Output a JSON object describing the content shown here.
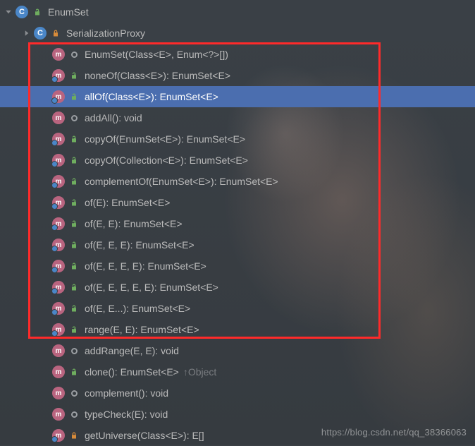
{
  "root": {
    "label": "EnumSet"
  },
  "innerClass": {
    "label": "SerializationProxy"
  },
  "members": [
    {
      "kind": "ctor",
      "vis": "pkg",
      "static": false,
      "label": "EnumSet(Class<E>, Enum<?>[])",
      "selected": false,
      "highlighted": true
    },
    {
      "kind": "method",
      "vis": "public",
      "static": true,
      "label": "noneOf(Class<E>): EnumSet<E>",
      "selected": false,
      "highlighted": true
    },
    {
      "kind": "method",
      "vis": "public",
      "static": true,
      "label": "allOf(Class<E>): EnumSet<E>",
      "selected": true,
      "highlighted": true
    },
    {
      "kind": "method",
      "vis": "pkg",
      "static": false,
      "label": "addAll(): void",
      "selected": false,
      "highlighted": true
    },
    {
      "kind": "method",
      "vis": "public",
      "static": true,
      "label": "copyOf(EnumSet<E>): EnumSet<E>",
      "selected": false,
      "highlighted": true
    },
    {
      "kind": "method",
      "vis": "public",
      "static": true,
      "label": "copyOf(Collection<E>): EnumSet<E>",
      "selected": false,
      "highlighted": true
    },
    {
      "kind": "method",
      "vis": "public",
      "static": true,
      "label": "complementOf(EnumSet<E>): EnumSet<E>",
      "selected": false,
      "highlighted": true
    },
    {
      "kind": "method",
      "vis": "public",
      "static": true,
      "label": "of(E): EnumSet<E>",
      "selected": false,
      "highlighted": true
    },
    {
      "kind": "method",
      "vis": "public",
      "static": true,
      "label": "of(E, E): EnumSet<E>",
      "selected": false,
      "highlighted": true
    },
    {
      "kind": "method",
      "vis": "public",
      "static": true,
      "label": "of(E, E, E): EnumSet<E>",
      "selected": false,
      "highlighted": true
    },
    {
      "kind": "method",
      "vis": "public",
      "static": true,
      "label": "of(E, E, E, E): EnumSet<E>",
      "selected": false,
      "highlighted": true
    },
    {
      "kind": "method",
      "vis": "public",
      "static": true,
      "label": "of(E, E, E, E, E): EnumSet<E>",
      "selected": false,
      "highlighted": true
    },
    {
      "kind": "method",
      "vis": "public",
      "static": true,
      "label": "of(E, E...): EnumSet<E>",
      "selected": false,
      "highlighted": true
    },
    {
      "kind": "method",
      "vis": "public",
      "static": true,
      "label": "range(E, E): EnumSet<E>",
      "selected": false,
      "highlighted": true
    },
    {
      "kind": "method",
      "vis": "pkg",
      "static": false,
      "label": "addRange(E, E): void",
      "selected": false,
      "highlighted": false
    },
    {
      "kind": "method",
      "vis": "public",
      "static": false,
      "label": "clone(): EnumSet<E>",
      "override": "↑Object",
      "selected": false,
      "highlighted": false
    },
    {
      "kind": "method",
      "vis": "pkg",
      "static": false,
      "label": "complement(): void",
      "selected": false,
      "highlighted": false
    },
    {
      "kind": "method",
      "vis": "pkg",
      "static": false,
      "label": "typeCheck(E): void",
      "selected": false,
      "highlighted": false
    },
    {
      "kind": "method",
      "vis": "private",
      "static": true,
      "label": "getUniverse(Class<E>): E[]",
      "selected": false,
      "highlighted": false
    }
  ],
  "watermark": "https://blog.csdn.net/qq_38366063"
}
